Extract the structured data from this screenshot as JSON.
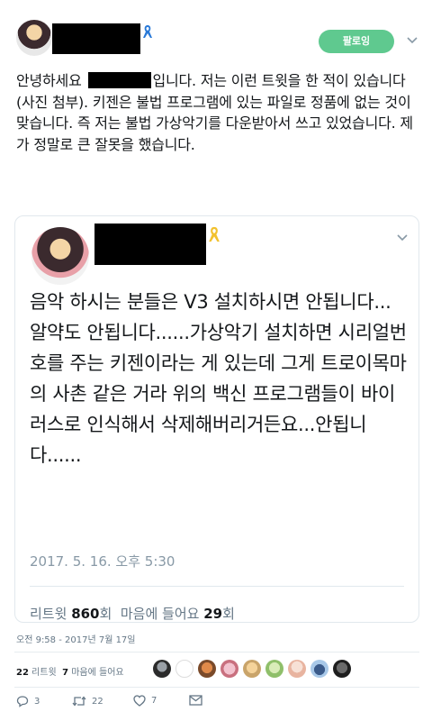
{
  "header": {
    "follow_label": "팔로잉"
  },
  "tweet": {
    "text_part1": "안녕하세요 ",
    "text_part2": "입니다. 저는 이런 트윗을 한 적이 있습니다(사진 첨부). 키젠은 불법 프로그램에 있는 파일로 정품에 없는 것이 맞습니다. 즉 저는 불법 가상악기를 다운받아서 쓰고 있었습니다. 제가 정말로 큰 잘못을 했습니다."
  },
  "quoted_tweet": {
    "text": "음악 하시는 분들은 V3 설치하시면 안됩니다...알약도 안됩니다......가상악기 설치하면 시리얼번호를 주는 키젠이라는 게 있는데 그게 트로이목마의 사촌 같은 거라 위의 백신 프로그램들이 바이러스로 인식해서 삭제해버리거든요...안됩니다......",
    "date": "2017. 5. 16. 오후 5:30",
    "retweet_label": "리트윗",
    "retweet_count": "860",
    "retweet_unit": "회",
    "like_label": "마음에 들어요",
    "like_count": "29",
    "like_unit": "회"
  },
  "timestamp": "오전 9:58 - 2017년 7월 17일",
  "stats": {
    "retweet_count": "22",
    "retweet_label": "리트윗",
    "like_count": "7",
    "like_label": "마음에 들어요"
  },
  "actions": {
    "reply_count": "3",
    "retweet_count": "22",
    "like_count": "7",
    "icons": [
      "reply-icon",
      "retweet-icon",
      "heart-icon",
      "mail-icon"
    ]
  },
  "colors": {
    "follow_green": "#5fc98f",
    "muted": "#657786",
    "border": "#e1e8ed"
  }
}
